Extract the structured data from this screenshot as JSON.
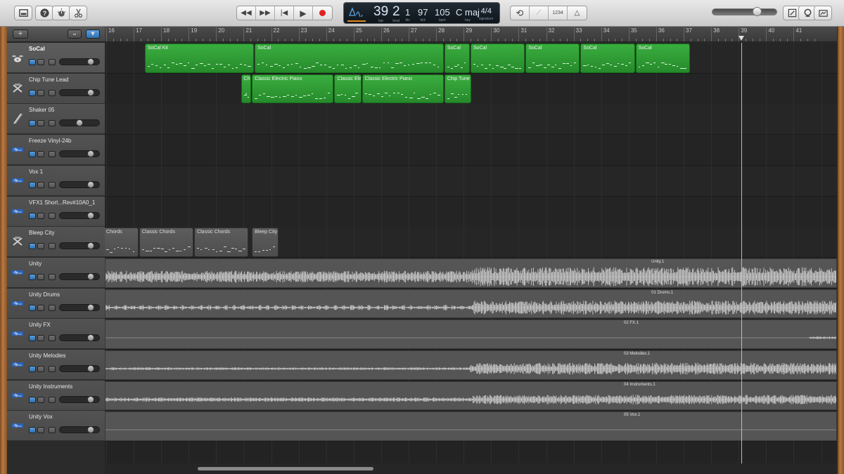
{
  "toolbar": {
    "library_icon": "library-icon",
    "help_icon": "question-icon",
    "smart_controls_icon": "knob-icon",
    "editors_icon": "scissors-icon",
    "transport": [
      "rewind-icon",
      "fast-forward-icon",
      "go-to-start-icon",
      "play-icon",
      "record-icon"
    ],
    "lcd": {
      "bar": "39",
      "bar_label": "bar",
      "beat": "2",
      "beat_label": "beat",
      "div": "1",
      "div_label": "div",
      "tick": "97",
      "tick_label": "tick",
      "tempo": "105",
      "tempo_label": "bpm",
      "key": "C maj",
      "key_label": "key",
      "signature": "4/4",
      "signature_label": "signature"
    },
    "count_in_label": "1234",
    "master_volume": 0.66,
    "right_icons": [
      "notepad-icon",
      "loops-icon",
      "media-browser-icon"
    ]
  },
  "header": {
    "add_track_label": "+",
    "smart_controls_label": "⬝⬝",
    "filter_label": "▾"
  },
  "ruler": {
    "bars": [
      "16",
      "17",
      "18",
      "19",
      "20",
      "21",
      "22",
      "23",
      "24",
      "25",
      "26",
      "27",
      "28",
      "29",
      "30",
      "31",
      "32",
      "33",
      "34",
      "35",
      "36",
      "37",
      "38",
      "39",
      "40",
      "41"
    ]
  },
  "tracks": [
    {
      "name": "SoCal",
      "icon": "drum-kit-icon",
      "selected": true,
      "volume": 0.82
    },
    {
      "name": "Chip Tune Lead",
      "icon": "synth-keyboard-icon",
      "volume": 0.82
    },
    {
      "name": "Shaker 05",
      "icon": "shaker-icon",
      "volume": 0.48
    },
    {
      "name": "Freeze Vinyl-24b",
      "icon": "audio-waveform-icon",
      "volume": 0.82
    },
    {
      "name": "Vox 1",
      "icon": "audio-waveform-icon",
      "volume": 0.82
    },
    {
      "name": "VFX1 Short...Rev#10A0_1",
      "icon": "audio-waveform-icon",
      "volume": 0.82
    },
    {
      "name": "Bleep City",
      "icon": "synth-keyboard-icon",
      "volume": 0.82
    },
    {
      "name": "Unity",
      "icon": "audio-waveform-icon",
      "volume": 0.82
    },
    {
      "name": "Unity Drums",
      "icon": "audio-waveform-icon",
      "volume": 0.82
    },
    {
      "name": "Unity FX",
      "icon": "audio-waveform-icon",
      "volume": 0.82
    },
    {
      "name": "Unity Melodies",
      "icon": "audio-waveform-icon",
      "volume": 0.82
    },
    {
      "name": "Unity Instruments",
      "icon": "audio-waveform-icon",
      "volume": 0.82
    },
    {
      "name": "Unity Vox",
      "icon": "audio-waveform-icon",
      "volume": 0.82
    }
  ],
  "regions": {
    "socal": [
      {
        "label": "SoCal Kit",
        "start_bar": 17.4,
        "end_bar": 21.4
      },
      {
        "label": "SoCal",
        "start_bar": 21.4,
        "end_bar": 28.3
      },
      {
        "label": "SoCal",
        "start_bar": 28.3,
        "end_bar": 29.25
      },
      {
        "label": "SoCal",
        "start_bar": 29.25,
        "end_bar": 31.25
      },
      {
        "label": "SoCal",
        "start_bar": 31.25,
        "end_bar": 33.25
      },
      {
        "label": "SoCal",
        "start_bar": 33.25,
        "end_bar": 35.25
      },
      {
        "label": "SoCal",
        "start_bar": 35.25,
        "end_bar": 37.25
      }
    ],
    "chip_tune": [
      {
        "label": "Chi",
        "start_bar": 20.9,
        "end_bar": 21.3
      },
      {
        "label": "Classic Electric Piano",
        "start_bar": 21.3,
        "end_bar": 24.3
      },
      {
        "label": "Classic Ele",
        "start_bar": 24.3,
        "end_bar": 25.3
      },
      {
        "label": "Classic Electric Piano",
        "start_bar": 25.3,
        "end_bar": 28.3
      },
      {
        "label": "Chip Tune",
        "start_bar": 28.3,
        "end_bar": 29.3
      }
    ],
    "bleep_city": [
      {
        "label": "Chords",
        "start_bar": 15.9,
        "end_bar": 17.2
      },
      {
        "label": "Classic Chords",
        "start_bar": 17.2,
        "end_bar": 19.2
      },
      {
        "label": "Classic Chords",
        "start_bar": 19.2,
        "end_bar": 21.2
      },
      {
        "label": "Bleep City",
        "start_bar": 21.3,
        "end_bar": 22.3
      }
    ],
    "audio": [
      {
        "track": "Unity",
        "label": "Unity.1",
        "label_bar": 35.8
      },
      {
        "track": "Unity Drums",
        "label": "01 Drums.1",
        "label_bar": 35.8
      },
      {
        "track": "Unity FX",
        "label": "02 FX.1",
        "label_bar": 34.8
      },
      {
        "track": "Unity Melodies",
        "label": "03 Melodies.1",
        "label_bar": 34.8
      },
      {
        "track": "Unity Instruments",
        "label": "04 Instruments.1",
        "label_bar": 34.8
      },
      {
        "track": "Unity Vox",
        "label": "05 Vox.1",
        "label_bar": 34.8
      }
    ]
  },
  "playhead_bar": 39.1,
  "colors": {
    "midi_region": "#2f9c35",
    "gray_region": "#555555",
    "wood": "#b97a42",
    "lcd_background": "#141b22"
  }
}
